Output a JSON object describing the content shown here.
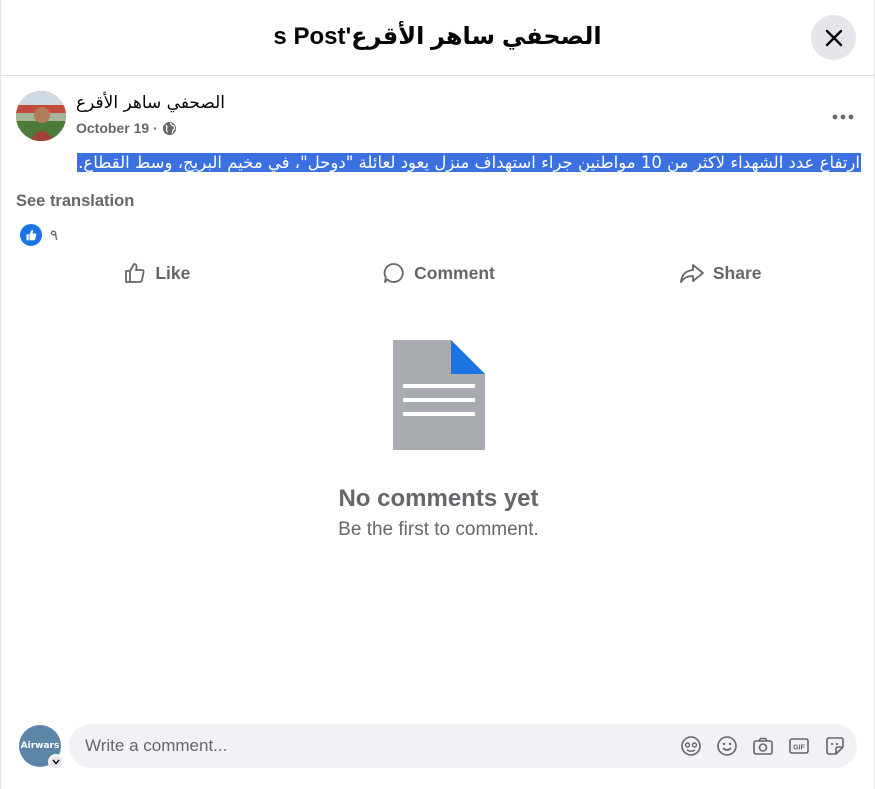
{
  "header": {
    "title": "الصحفي ساهر الأقرع's Post",
    "close_icon": "close-icon"
  },
  "post": {
    "author": "الصحفي ساهر الأقرع",
    "date": "October 19",
    "separator": "·",
    "privacy_icon": "globe-icon",
    "more_icon": "more-dots-icon",
    "text": "ارتفاع عدد الشهداء لاكثر من 10 مواطنين جراء استهداف منزل يعود لعائلة \"دوحل\"، في مخيم البريج، وسط القطاع.",
    "see_translation": "See translation",
    "reaction_count": "٩"
  },
  "actions": {
    "like": "Like",
    "comment": "Comment",
    "share": "Share"
  },
  "empty_state": {
    "title": "No comments yet",
    "subtitle": "Be the first to comment."
  },
  "composer": {
    "avatar_label": "Airwars",
    "placeholder": "Write a comment...",
    "tools": [
      "avatar-sticker-icon",
      "emoji-icon",
      "camera-icon",
      "gif-icon",
      "sticker-icon"
    ]
  },
  "colors": {
    "accent": "#1b74e4",
    "highlight": "#3b70e0",
    "muted": "#65676b"
  }
}
